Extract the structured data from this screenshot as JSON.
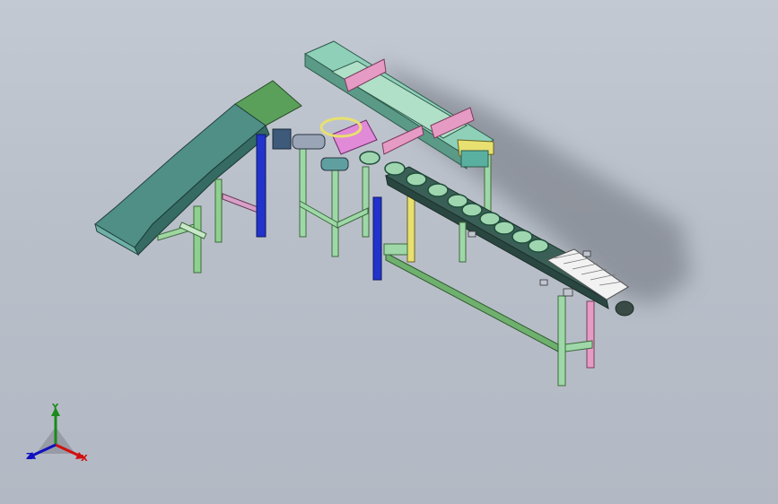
{
  "viewport": {
    "background_top": "#c3c9d2",
    "background_bottom": "#b3b9c4"
  },
  "triad": {
    "x_label": "X",
    "y_label": "Y",
    "z_label": "Z",
    "x_color": "#d01010",
    "y_color": "#1a8a1a",
    "z_color": "#1010c0"
  },
  "model": {
    "icons": [
      "inclined-conveyor",
      "gantry-frame",
      "belt-conveyor",
      "support-legs"
    ],
    "colors": {
      "frame_green": "#7fbf7f",
      "hopper_green": "#5aa05a",
      "chute_teal": "#4f8f86",
      "blue_post": "#2233cc",
      "pink_part": "#e59bc4",
      "magenta_plate": "#e08ad8",
      "yellow_post": "#e8e070",
      "conveyor_dark": "#3a5f56",
      "cup_green": "#9fd6b0",
      "shadow": "#6c717a"
    }
  }
}
